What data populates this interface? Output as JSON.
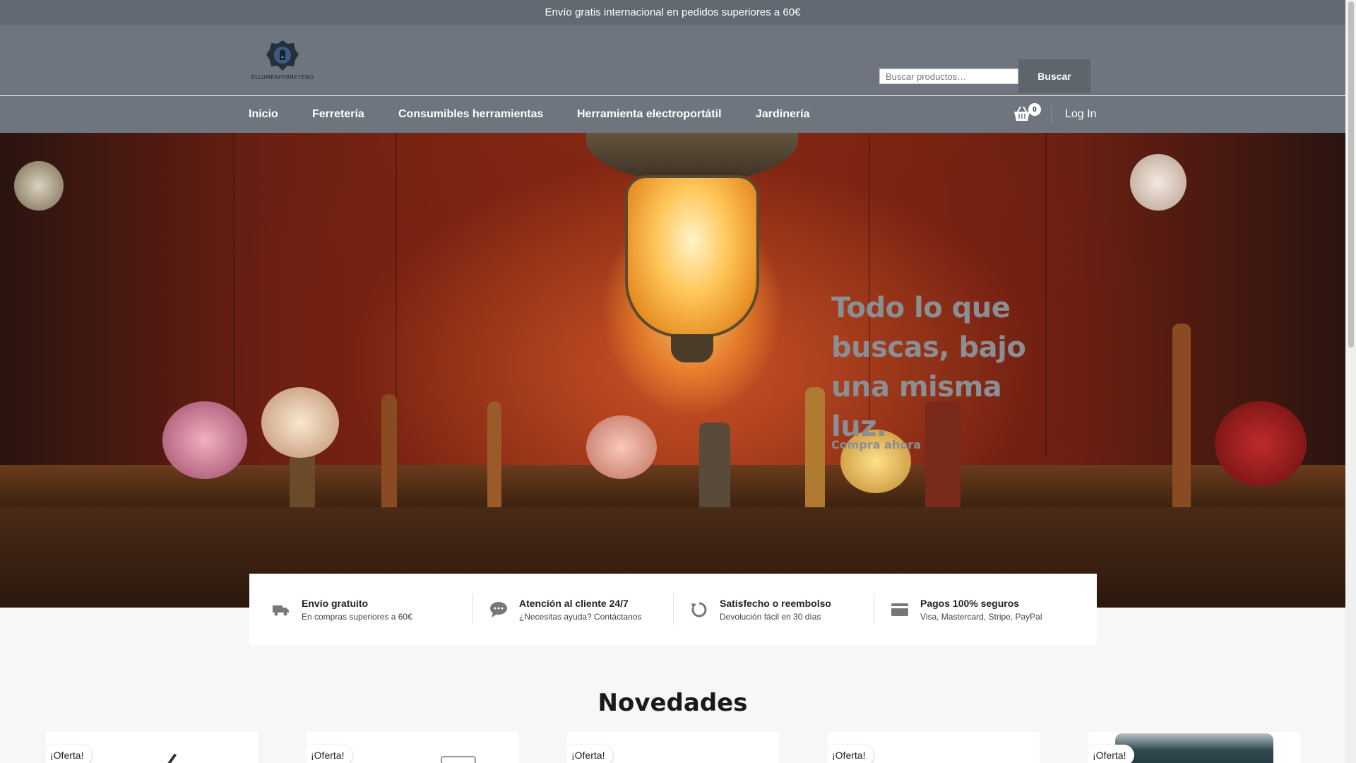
{
  "topbar": {
    "text": "Envío gratis internacional en pedidos superiores a 60€"
  },
  "header": {
    "logo_text": "ELLUMENFERRETERO",
    "search_placeholder": "Buscar productos…",
    "search_button": "Buscar"
  },
  "nav": {
    "items": [
      "Inicio",
      "Ferretería",
      "Consumibles herramientas",
      "Herramienta electroportátil",
      "Jardinería"
    ],
    "cart_count": "0",
    "login": "Log In"
  },
  "hero": {
    "title": "Todo lo que buscas, bajo una misma luz.",
    "cta": "Compra ahora"
  },
  "features": [
    {
      "icon": "truck-icon",
      "title": "Envío gratuito",
      "subtitle": "En compras superiores a 60€"
    },
    {
      "icon": "chat-icon",
      "title": "Atención al cliente 24/7",
      "subtitle": "¿Necesitas ayuda? Contáctanos"
    },
    {
      "icon": "refund-icon",
      "title": "Satisfecho o reembolso",
      "subtitle": "Devolución fácil en 30 días"
    },
    {
      "icon": "credit-card-icon",
      "title": "Pagos 100% seguros",
      "subtitle": "Visa, Mastercard, Stripe, PayPal"
    }
  ],
  "section": {
    "title": "Novedades"
  },
  "products": [
    {
      "badge": "¡Oferta!"
    },
    {
      "badge": "¡Oferta!"
    },
    {
      "badge": "¡Oferta!"
    },
    {
      "badge": "¡Oferta!"
    },
    {
      "badge": "¡Oferta!"
    }
  ],
  "colors": {
    "header_bg": "#6e757e",
    "topbar_bg": "#636972",
    "hero_text": "#8b8e93"
  }
}
